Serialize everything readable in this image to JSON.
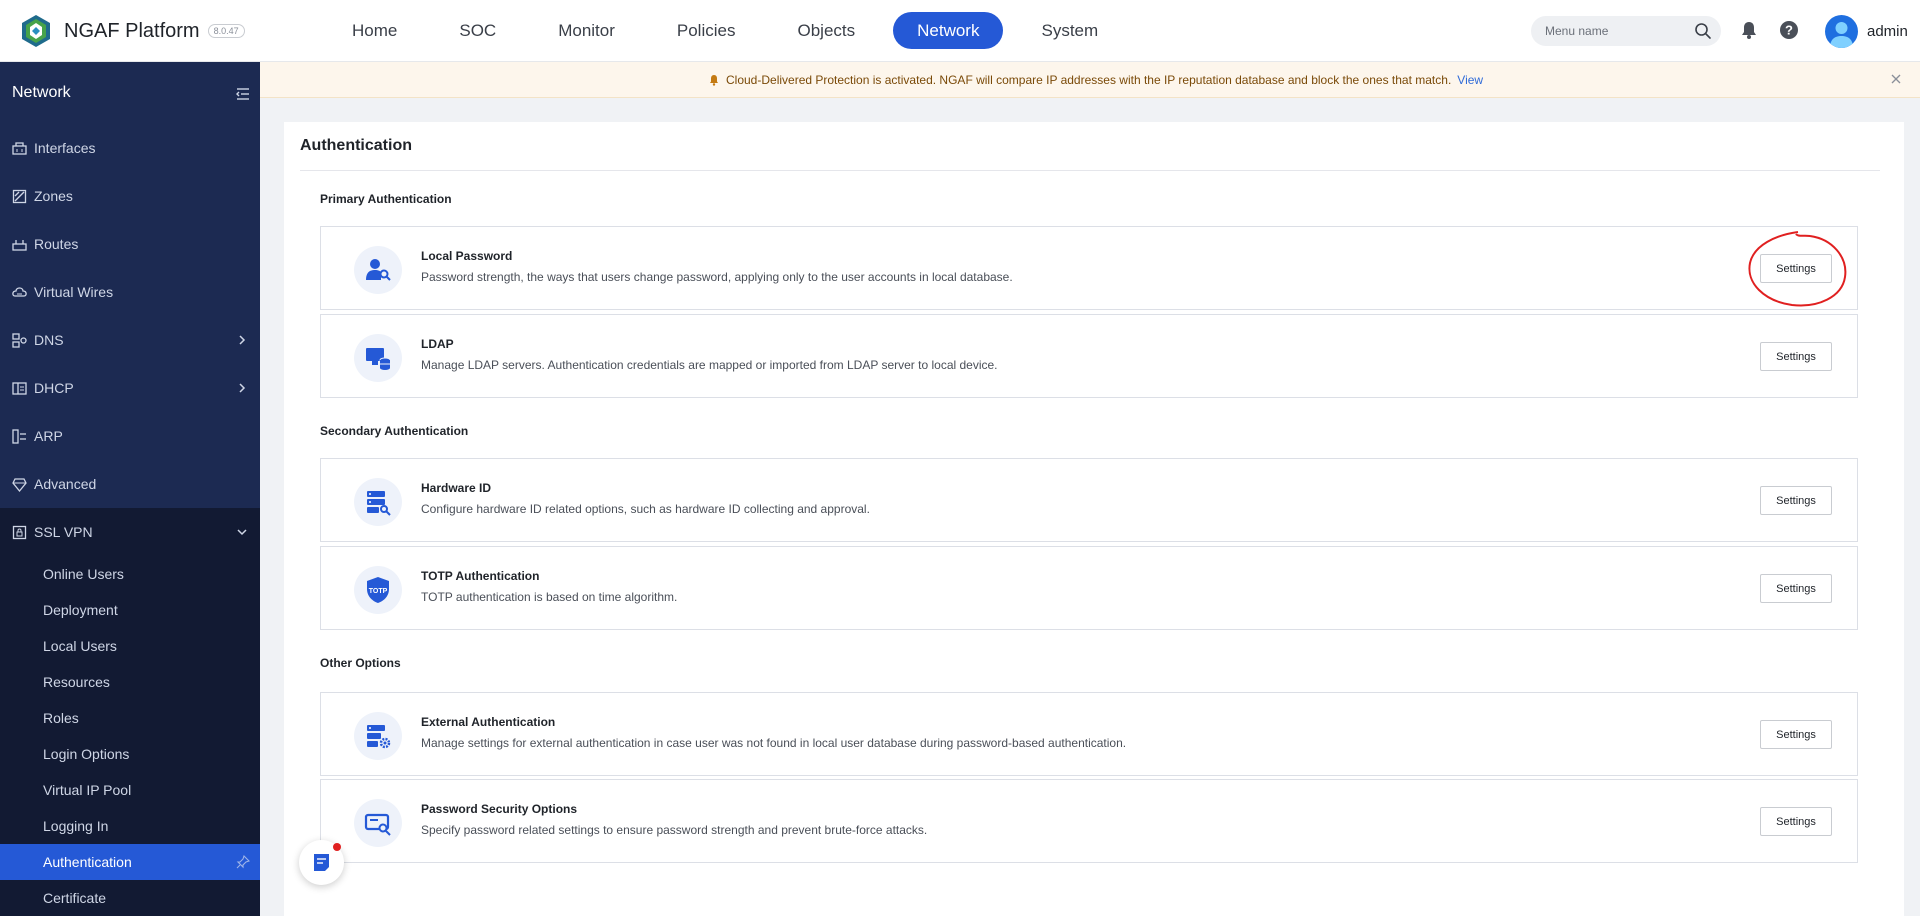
{
  "app": {
    "name": "NGAF Platform",
    "version": "8.0.47"
  },
  "nav": {
    "items": [
      {
        "label": "Home"
      },
      {
        "label": "SOC"
      },
      {
        "label": "Monitor"
      },
      {
        "label": "Policies"
      },
      {
        "label": "Objects"
      },
      {
        "label": "Network"
      },
      {
        "label": "System"
      }
    ],
    "active": "Network"
  },
  "search": {
    "placeholder": "Menu name"
  },
  "user": {
    "name": "admin"
  },
  "sidebar": {
    "title": "Network",
    "items": [
      {
        "label": "Interfaces",
        "icon": "interfaces-icon"
      },
      {
        "label": "Zones",
        "icon": "zones-icon"
      },
      {
        "label": "Routes",
        "icon": "routes-icon"
      },
      {
        "label": "Virtual Wires",
        "icon": "virtual-wires-icon"
      },
      {
        "label": "DNS",
        "icon": "dns-icon",
        "expandable": true
      },
      {
        "label": "DHCP",
        "icon": "dhcp-icon",
        "expandable": true
      },
      {
        "label": "ARP",
        "icon": "arp-icon"
      },
      {
        "label": "Advanced",
        "icon": "advanced-icon"
      },
      {
        "label": "SSL VPN",
        "icon": "ssl-vpn-icon",
        "expanded": true
      }
    ],
    "ssl_vpn_children": [
      {
        "label": "Online Users"
      },
      {
        "label": "Deployment"
      },
      {
        "label": "Local Users"
      },
      {
        "label": "Resources"
      },
      {
        "label": "Roles"
      },
      {
        "label": "Login Options"
      },
      {
        "label": "Virtual IP Pool"
      },
      {
        "label": "Logging In"
      },
      {
        "label": "Authentication",
        "active": true
      },
      {
        "label": "Certificate"
      }
    ]
  },
  "banner": {
    "text": "Cloud-Delivered Protection is activated. NGAF will compare IP addresses with the IP reputation database and block the ones that match.",
    "link": "View"
  },
  "page": {
    "title": "Authentication",
    "sections": [
      {
        "title": "Primary Authentication",
        "rows": [
          {
            "title": "Local Password",
            "desc": "Password strength, the ways that users change password, applying only to the user accounts in local database.",
            "button": "Settings",
            "icon": "local-password-icon"
          },
          {
            "title": "LDAP",
            "desc": "Manage LDAP servers. Authentication credentials are mapped or imported from LDAP server to local device.",
            "button": "Settings",
            "icon": "ldap-icon"
          }
        ]
      },
      {
        "title": "Secondary Authentication",
        "rows": [
          {
            "title": "Hardware ID",
            "desc": "Configure hardware ID related options, such as hardware ID collecting and approval.",
            "button": "Settings",
            "icon": "hardware-id-icon"
          },
          {
            "title": "TOTP Authentication",
            "desc": "TOTP authentication is based on time algorithm.",
            "button": "Settings",
            "icon": "totp-icon",
            "icon_text": "TOTP"
          }
        ]
      },
      {
        "title": "Other Options",
        "rows": [
          {
            "title": "External Authentication",
            "desc": "Manage settings for external authentication in case user was not found in local user database during password-based authentication.",
            "button": "Settings",
            "icon": "external-auth-icon"
          },
          {
            "title": "Password Security Options",
            "desc": "Specify password related settings to ensure password strength and prevent brute-force attacks.",
            "button": "Settings",
            "icon": "password-security-icon"
          }
        ]
      }
    ]
  },
  "colors": {
    "accent": "#2559d6",
    "sidebar": "#1c2a52",
    "sidebar_dark": "#121a33",
    "annotation": "#e02020"
  }
}
